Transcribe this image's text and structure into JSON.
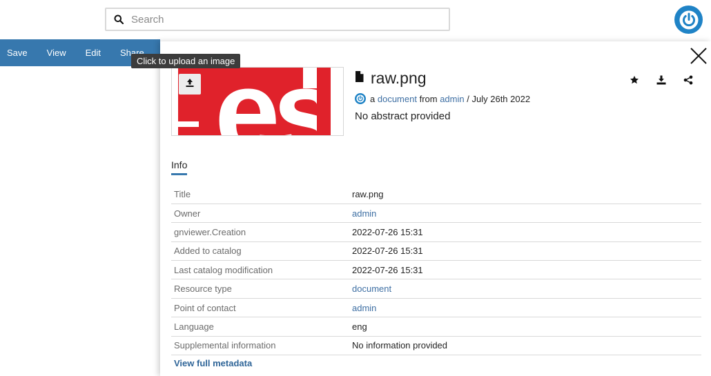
{
  "search": {
    "placeholder": "Search"
  },
  "toolbar": {
    "items": [
      "Save",
      "View",
      "Edit",
      "Share"
    ]
  },
  "tooltip": {
    "text": "Click to upload an image"
  },
  "resource": {
    "title": "raw.png",
    "meta": {
      "prefix": "a",
      "type_link": "document",
      "from": "from",
      "owner_link": "admin",
      "sep": "/",
      "date": "July 26th 2022"
    },
    "abstract": "No abstract provided",
    "thumbnail_text": "es"
  },
  "tabs": {
    "info": "Info"
  },
  "info_rows": [
    {
      "label": "Title",
      "value": "raw.png",
      "link": false
    },
    {
      "label": "Owner",
      "value": "admin",
      "link": true
    },
    {
      "label": "gnviewer.Creation",
      "value": "2022-07-26 15:31",
      "link": false
    },
    {
      "label": "Added to catalog",
      "value": "2022-07-26 15:31",
      "link": false
    },
    {
      "label": "Last catalog modification",
      "value": "2022-07-26 15:31",
      "link": false
    },
    {
      "label": "Resource type",
      "value": "document",
      "link": true
    },
    {
      "label": "Point of contact",
      "value": "admin",
      "link": true
    },
    {
      "label": "Language",
      "value": "eng",
      "link": false
    },
    {
      "label": "Supplemental information",
      "value": "No information provided",
      "link": false
    }
  ],
  "view_full": "View full metadata",
  "colors": {
    "toolbar": "#3778ae",
    "brand": "#1f83c6",
    "link": "#3e6fa3",
    "thumb_red": "#e0222b"
  },
  "icons": [
    "search-icon",
    "power-logo-icon",
    "close-icon",
    "upload-icon",
    "file-icon",
    "star-icon",
    "download-icon",
    "share-icon"
  ]
}
